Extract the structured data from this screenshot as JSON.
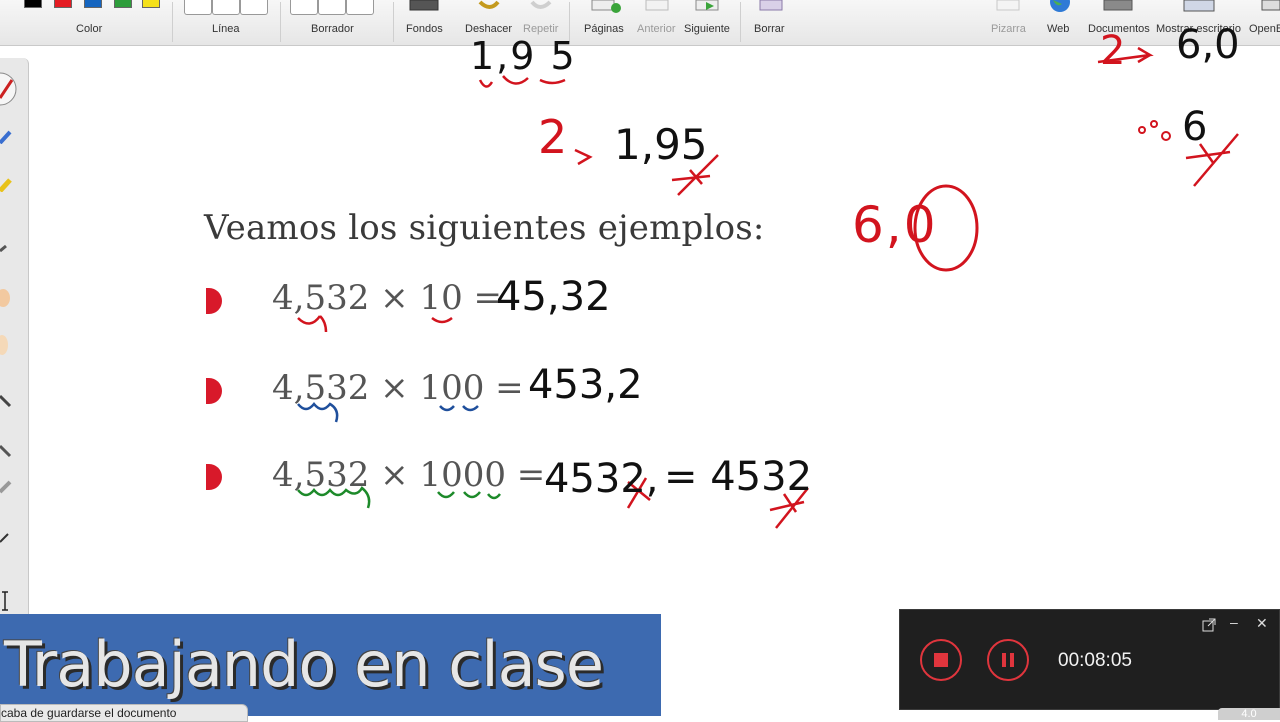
{
  "toolbar": {
    "groups": {
      "color": "Color",
      "line": "Línea",
      "eraser": "Borrador"
    },
    "buttons": {
      "backgrounds": "Fondos",
      "undo": "Deshacer",
      "redo": "Repetir",
      "pages": "Páginas",
      "previous": "Anterior",
      "next": "Siguiente",
      "clear": "Borrar",
      "whiteboard": "Pizarra",
      "web": "Web",
      "documents": "Documentos",
      "show_desktop": "Mostrar escritorio",
      "open": "OpenB"
    },
    "swatch_colors": [
      "#000000",
      "#e51c23",
      "#1565c0",
      "#2e9d3b",
      "#f5e11b"
    ]
  },
  "content": {
    "heading": "Veamos los siguientes ejemplos:",
    "examples": [
      {
        "expr": "4,532 × 10 =",
        "answer": "45,32"
      },
      {
        "expr": "4,532 ×  100 =",
        "answer": "453,2"
      },
      {
        "expr": "4,532 ×  1000 =",
        "answer": "4532,",
        "answer2": "= 4532"
      }
    ],
    "handwriting": {
      "top_partial": "1,9 5",
      "step_label": "2",
      "step_value": "1,95",
      "right_top_label": "2",
      "right_top_value": "6,0",
      "right_mid_value": "6",
      "red_value": "6,0"
    }
  },
  "banner": {
    "title": "Trabajando en clase"
  },
  "status": {
    "message": "caba de guardarse el documento"
  },
  "recorder": {
    "time": "00:08:05",
    "stop_color": "#e0353d"
  },
  "corner_badge": "4.0"
}
